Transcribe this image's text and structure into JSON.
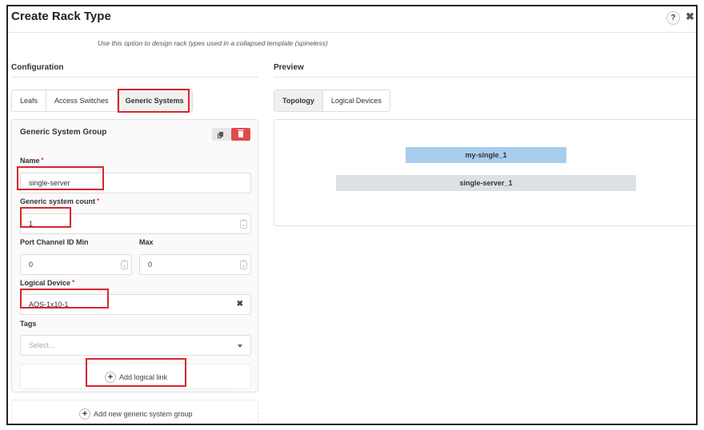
{
  "modal": {
    "title": "Create Rack Type",
    "help": "?",
    "close": "✖",
    "subtitle": "Use this option to design rack types used in a collapsed template (spineless)"
  },
  "configuration": {
    "title": "Configuration",
    "tabs": [
      {
        "label": "Leafs",
        "active": false
      },
      {
        "label": "Access Switches",
        "active": false
      },
      {
        "label": "Generic Systems",
        "active": true
      }
    ],
    "group": {
      "title": "Generic System Group",
      "name_label": "Name",
      "name_value": "single-server",
      "count_label": "Generic system count",
      "count_value": "1",
      "port_min_label": "Port Channel ID Min",
      "port_min_value": "0",
      "max_label": "Max",
      "max_value": "0",
      "logical_device_label": "Logical Device",
      "logical_device_value": "AOS-1x10-1",
      "tags_label": "Tags",
      "tags_placeholder": "Select...",
      "add_link_label": "Add logical link",
      "required_mark": "*"
    },
    "add_group_label": "Add new generic system group"
  },
  "preview": {
    "title": "Preview",
    "tabs": [
      {
        "label": "Topology",
        "active": true
      },
      {
        "label": "Logical Devices",
        "active": false
      }
    ],
    "nodes": {
      "upper": "my-single_1",
      "lower": "single-server_1"
    }
  },
  "colors": {
    "highlight": "#d9262c",
    "delete": "#e14b4b",
    "node_upper": "#a8cdef",
    "node_lower": "#dde1e5"
  }
}
